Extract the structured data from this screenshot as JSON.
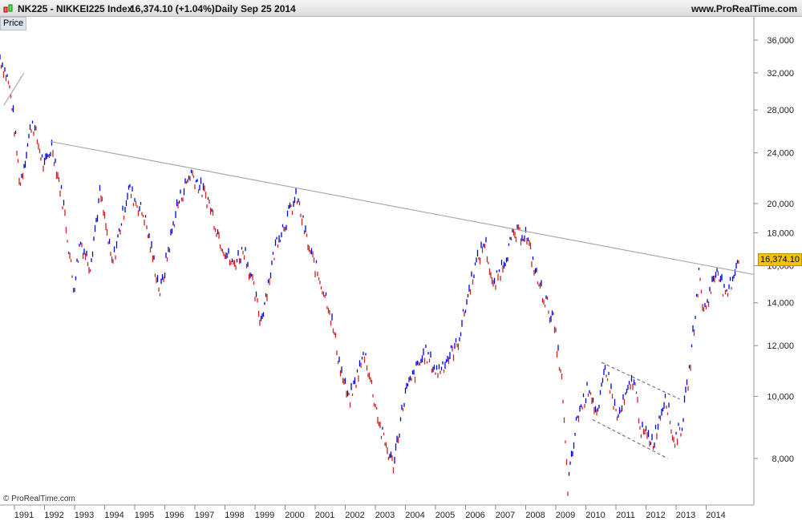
{
  "header": {
    "symbol": "NK225 - NIKKEI225 Index",
    "price": "16,374.10 (+1.04%)",
    "period": "Daily",
    "date": "Sep 25 2014",
    "site": "www.ProRealTime.com"
  },
  "panel_label": "Price",
  "copyright": "© ProRealTime.com",
  "colors": {
    "up": "#0000dd",
    "down": "#cc2222",
    "trend": "#aaaaaa",
    "badge": "#f5c400"
  },
  "chart_data": {
    "type": "line",
    "title": "NK225 - NIKKEI225 Index",
    "yscale": "log",
    "ylim": [
      6800,
      40000
    ],
    "xlim": [
      1990.2,
      2015.6
    ],
    "last_value_label": "16,374.10",
    "y_ticks": [
      {
        "v": 36000,
        "label": "36,000"
      },
      {
        "v": 32000,
        "label": "32,000"
      },
      {
        "v": 28000,
        "label": "28,000"
      },
      {
        "v": 24000,
        "label": "24,000"
      },
      {
        "v": 20000,
        "label": "20,000"
      },
      {
        "v": 18000,
        "label": "18,000"
      },
      {
        "v": 16000,
        "label": "16,000"
      },
      {
        "v": 14000,
        "label": "14,000"
      },
      {
        "v": 12000,
        "label": "12,000"
      },
      {
        "v": 10000,
        "label": "10,000"
      },
      {
        "v": 8000,
        "label": "8,000"
      }
    ],
    "x_ticks": [
      "1991",
      "1992",
      "1993",
      "1994",
      "1995",
      "1996",
      "1997",
      "1998",
      "1999",
      "2000",
      "2001",
      "2002",
      "2003",
      "2004",
      "2005",
      "2006",
      "2007",
      "2008",
      "2009",
      "2010",
      "2011",
      "2012",
      "2013",
      "2014"
    ],
    "series": [
      {
        "name": "NK225",
        "t": [
          1990.2,
          1990.47,
          1990.6,
          1990.87,
          1991.27,
          1991.67,
          1991.93,
          1992.33,
          1992.65,
          1992.87,
          1993.19,
          1993.53,
          1993.93,
          1994.47,
          1995.0,
          1995.53,
          1996.07,
          1996.55,
          1997.13,
          1997.53,
          1997.93,
          1998.33,
          1998.87,
          1999.4,
          2000.07,
          2000.47,
          2001.13,
          2001.53,
          2001.8,
          2002.33,
          2002.87,
          2003.27,
          2003.67,
          2004.33,
          2004.73,
          2005.4,
          2005.93,
          2006.33,
          2006.6,
          2007.27,
          2007.67,
          2008.07,
          2008.6,
          2008.87,
          2009.08,
          2009.4,
          2009.8,
          2010.07,
          2010.33,
          2010.73,
          2011.27,
          2011.53,
          2011.93,
          2012.33,
          2012.6,
          2012.87,
          2013.13,
          2013.45,
          2013.6,
          2014.07,
          2014.33,
          2014.6,
          2014.73
        ],
        "v": [
          33900,
          31100,
          28600,
          21400,
          27000,
          22700,
          24700,
          19700,
          14700,
          17500,
          16000,
          20800,
          16000,
          21100,
          19100,
          14500,
          19700,
          22400,
          20200,
          17500,
          16000,
          17000,
          13100,
          17500,
          20500,
          17000,
          13900,
          11000,
          9800,
          11700,
          8800,
          7800,
          10100,
          11700,
          10900,
          12000,
          15600,
          17500,
          14700,
          17800,
          18000,
          15200,
          13100,
          10700,
          7200,
          9300,
          10400,
          9200,
          11200,
          9200,
          10700,
          8800,
          8500,
          10100,
          8500,
          9000,
          11000,
          15600,
          13500,
          16000,
          14100,
          15600,
          16374
        ]
      }
    ],
    "trendlines": [
      {
        "name": "long-term-resistance",
        "from": [
          1991.88,
          25000
        ],
        "to": [
          2015.27,
          15500
        ],
        "style": "solid"
      },
      {
        "name": "early-trend",
        "from": [
          1990.33,
          28500
        ],
        "to": [
          1991.0,
          32000
        ],
        "style": "solid"
      },
      {
        "name": "channel-upper",
        "from": [
          2010.2,
          11300
        ],
        "to": [
          2012.8,
          9900
        ],
        "style": "dashed"
      },
      {
        "name": "channel-lower",
        "from": [
          2009.9,
          9200
        ],
        "to": [
          2012.4,
          8000
        ],
        "style": "dashed"
      }
    ]
  }
}
